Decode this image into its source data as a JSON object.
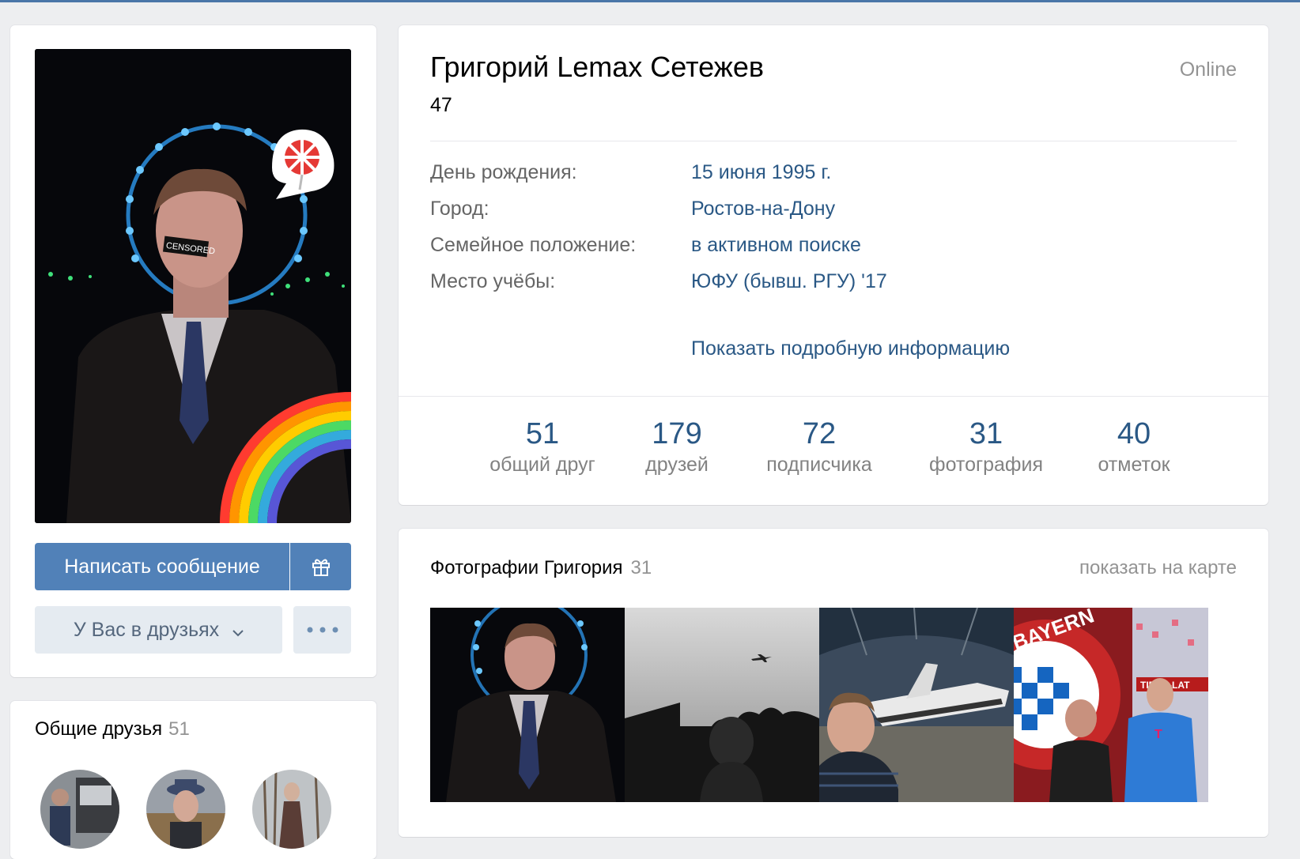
{
  "profile": {
    "name": "Григорий Lemax Сетежев",
    "age": "47",
    "status": "Online",
    "details": [
      {
        "label": "День рождения:",
        "value": "15 июня 1995 г."
      },
      {
        "label": "Город:",
        "value": "Ростов-на-Дону"
      },
      {
        "label": "Семейное положение:",
        "value": "в активном поиске"
      },
      {
        "label": "Место учёбы:",
        "value": "ЮФУ (бывш. РГУ) '17"
      }
    ],
    "more_info": "Показать подробную информацию",
    "counters": [
      {
        "value": "51",
        "label": "общий друг"
      },
      {
        "value": "179",
        "label": "друзей"
      },
      {
        "value": "72",
        "label": "подписчика"
      },
      {
        "value": "31",
        "label": "фотография"
      },
      {
        "value": "40",
        "label": "отметок"
      }
    ]
  },
  "actions": {
    "message": "Написать сообщение",
    "friend_status": "У Вас в друзьях"
  },
  "avatar": {
    "sticker_text": "CENSORED"
  },
  "mutual_friends": {
    "title": "Общие друзья",
    "count": "51"
  },
  "photos": {
    "title": "Фотографии Григория",
    "count": "31",
    "map_link": "показать на карте",
    "poster_text": "BAYERN",
    "banner_text": "TIROL-LAT"
  },
  "colors": {
    "accent": "#5181b8",
    "link": "#2a5885",
    "background": "#edeef0"
  },
  "icons": [
    "gift-icon",
    "chevron-down-icon",
    "more-dots-icon"
  ]
}
